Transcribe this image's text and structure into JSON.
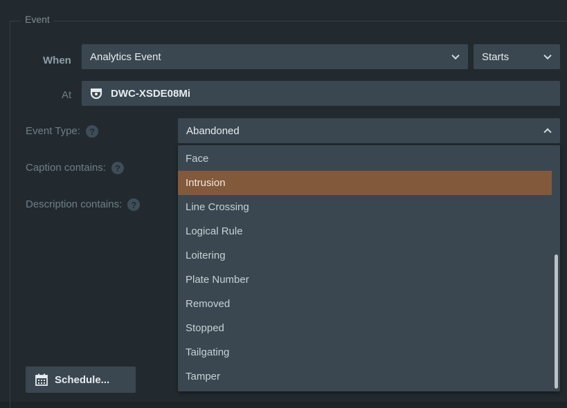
{
  "group": {
    "title": "Event"
  },
  "when": {
    "label": "When",
    "value": "Analytics Event",
    "qualifier": "Starts"
  },
  "at": {
    "label": "At",
    "device": "DWC-XSDE08Mi"
  },
  "event_type": {
    "label": "Event Type:",
    "value": "Abandoned",
    "options": [
      "Face",
      "Intrusion",
      "Line Crossing",
      "Logical Rule",
      "Loitering",
      "Plate Number",
      "Removed",
      "Stopped",
      "Tailgating",
      "Tamper"
    ],
    "selected": "Intrusion"
  },
  "caption": {
    "label": "Caption contains:"
  },
  "description": {
    "label": "Description contains:"
  },
  "help_glyph": "?",
  "schedule": {
    "label": "Schedule..."
  },
  "colors": {
    "highlight": "#83593c",
    "field_bg": "#3a4750",
    "panel_bg": "#222a2f"
  },
  "icons": {
    "device": "camera-icon",
    "schedule": "calendar-icon",
    "help": "help-icon"
  }
}
